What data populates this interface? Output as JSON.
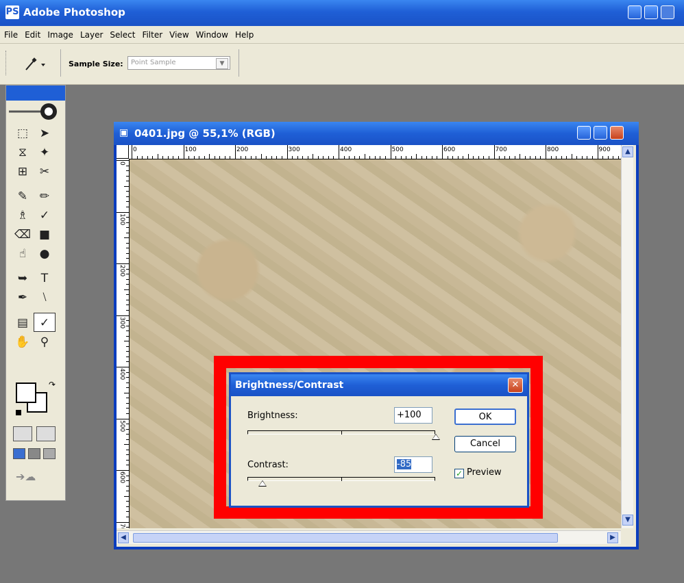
{
  "app": {
    "title": "Adobe Photoshop",
    "logo": "PS",
    "menu": [
      "File",
      "Edit",
      "Image",
      "Layer",
      "Select",
      "Filter",
      "View",
      "Window",
      "Help"
    ]
  },
  "options_bar": {
    "tool_icon": "eyedropper-icon",
    "sample_size_label": "Sample Size:",
    "sample_size_value": "Point Sample"
  },
  "document": {
    "title": "0401.jpg @ 55,1% (RGB)",
    "ruler_top_labels": [
      "0",
      "100",
      "200",
      "300",
      "400",
      "500",
      "600",
      "700",
      "800",
      "900"
    ],
    "ruler_left_labels": [
      "0",
      "100",
      "200",
      "300",
      "400",
      "500",
      "600",
      "700"
    ]
  },
  "dialog": {
    "title": "Brightness/Contrast",
    "brightness_label": "Brightness:",
    "brightness_value": "+100",
    "brightness_level": 100,
    "contrast_label": "Contrast:",
    "contrast_value": "-85",
    "contrast_level": -85,
    "ok_label": "OK",
    "cancel_label": "Cancel",
    "preview_label": "Preview",
    "preview_checked": true
  },
  "colors": {
    "titlebar": "#1f5fd6",
    "highlight": "#ff0000",
    "workspace": "#777777"
  }
}
